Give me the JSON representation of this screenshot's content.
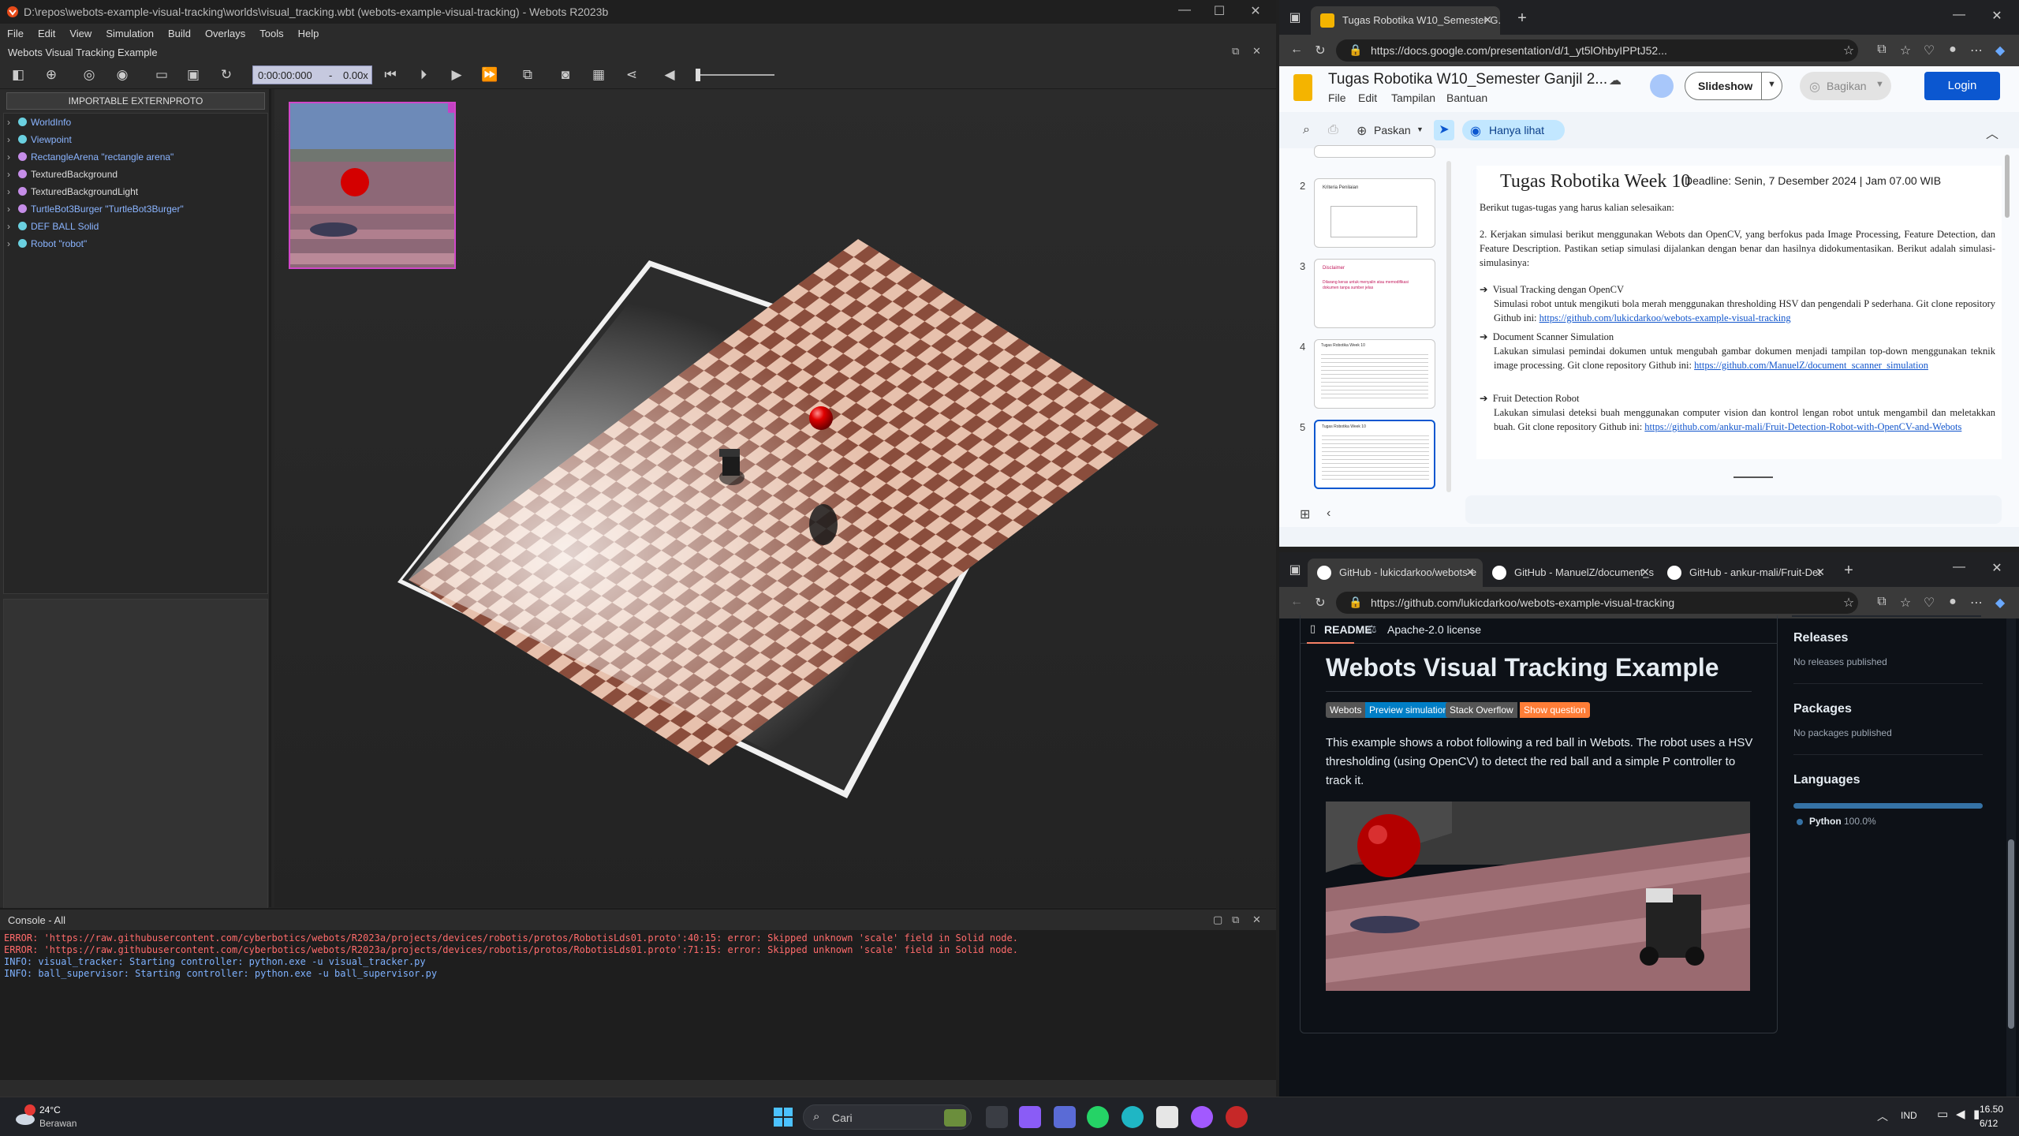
{
  "webots": {
    "title": "D:\\repos\\webots-example-visual-tracking\\worlds\\visual_tracking.wbt (webots-example-visual-tracking) - Webots R2023b",
    "menu": [
      "File",
      "Edit",
      "View",
      "Simulation",
      "Build",
      "Overlays",
      "Tools",
      "Help"
    ],
    "subtitle": "Webots Visual Tracking Example",
    "time": "0:00:00:000",
    "time_sep": "-",
    "speed": "0.00x",
    "extern_button": "IMPORTABLE EXTERNPROTO",
    "tree": [
      {
        "label": "WorldInfo",
        "color": "#6ad0e0"
      },
      {
        "label": "Viewpoint",
        "color": "#6ad0e0"
      },
      {
        "label": "RectangleArena \"rectangle arena\"",
        "color": "#c58de8"
      },
      {
        "label": "TexturedBackground",
        "color": "#c58de8"
      },
      {
        "label": "TexturedBackgroundLight",
        "color": "#c58de8"
      },
      {
        "label": "TurtleBot3Burger \"TurtleBot3Burger\"",
        "color": "#c58de8"
      },
      {
        "label": "DEF BALL Solid",
        "color": "#6ad0e0"
      },
      {
        "label": "Robot \"robot\"",
        "color": "#6ad0e0"
      }
    ],
    "console_title": "Console - All",
    "console": [
      {
        "type": "err",
        "text": "ERROR: 'https://raw.githubusercontent.com/cyberbotics/webots/R2023a/projects/devices/robotis/protos/RobotisLds01.proto':40:15: error: Skipped unknown 'scale' field in Solid node."
      },
      {
        "type": "err",
        "text": "ERROR: 'https://raw.githubusercontent.com/cyberbotics/webots/R2023a/projects/devices/robotis/protos/RobotisLds01.proto':71:15: error: Skipped unknown 'scale' field in Solid node."
      },
      {
        "type": "info",
        "text": "INFO: visual_tracker: Starting controller: python.exe -u visual_tracker.py"
      },
      {
        "type": "info",
        "text": "INFO: ball_supervisor: Starting controller: python.exe -u ball_supervisor.py"
      }
    ]
  },
  "slides": {
    "tab_title": "Tugas Robotika W10_Semester G...",
    "url": "https://docs.google.com/presentation/d/1_yt5lOhbyIPPtJ52...",
    "doc_title": "Tugas Robotika W10_Semester Ganjil 2...",
    "menu": [
      "File",
      "Edit",
      "Tampilan",
      "Bantuan"
    ],
    "slideshow": "Slideshow",
    "share": "Bagikan",
    "login": "Login",
    "zoom_label": "Paskan",
    "view_only": "Hanya lihat",
    "thumb_numbers": [
      "2",
      "3",
      "4",
      "5"
    ],
    "thumb_headers": [
      "Kriteria Penilaian",
      "Disclaimer",
      "Tugas Robotika Week 10",
      "Tugas Robotika Week 10"
    ],
    "thumb3_body": "Dilarang keras untuk menyalin atau memodifikasi dokumen tanpa sumber jelas",
    "slide": {
      "heading": "Tugas Robotika Week 10",
      "deadline": "Deadline: Senin, 7 Desember 2024  | Jam 07.00 WIB",
      "intro": "Berikut tugas-tugas yang harus kalian selesaikan:",
      "item2": "2.  Kerjakan simulasi berikut menggunakan Webots dan OpenCV, yang berfokus pada Image Processing, Feature Detection, dan Feature Description. Pastikan setiap simulasi dijalankan dengan benar dan hasilnya didokumentasikan. Berikut adalah simulasi-simulasinya:",
      "sections": [
        {
          "title": "Visual Tracking dengan OpenCV",
          "body": "Simulasi robot untuk mengikuti bola merah menggunakan thresholding HSV dan pengendali P sederhana. Git clone repository Github ini: ",
          "link": "https://github.com/lukicdarkoo/webots-example-visual-tracking"
        },
        {
          "title": "Document Scanner Simulation",
          "body": "Lakukan simulasi pemindai dokumen untuk mengubah gambar dokumen menjadi tampilan top-down menggunakan teknik image processing. Git clone repository Github ini: ",
          "link": "https://github.com/ManuelZ/document_scanner_simulation"
        },
        {
          "title": "Fruit Detection Robot",
          "body": "Lakukan simulasi deteksi buah menggunakan computer vision dan kontrol lengan robot untuk mengambil dan meletakkan buah. Git clone repository Github ini: ",
          "link": "https://github.com/ankur-mali/Fruit-Detection-Robot-with-OpenCV-and-Webots"
        }
      ]
    }
  },
  "github": {
    "tabs": [
      "GitHub - lukicdarkoo/webots-e",
      "GitHub - ManuelZ/document_s",
      "GitHub - ankur-mali/Fruit-Det"
    ],
    "url": "https://github.com/lukicdarkoo/webots-example-visual-tracking",
    "readme_tab": "README",
    "license_tab": "Apache-2.0 license",
    "heading": "Webots Visual Tracking Example",
    "badges": [
      {
        "left": "Webots",
        "right": "Preview simulation",
        "color": "#007ec6"
      },
      {
        "left": "Stack Overflow",
        "right": "Show question",
        "color": "#fe7d37"
      }
    ],
    "description": "This example shows a robot following a red ball in Webots. The robot uses a HSV thresholding (using OpenCV) to detect the red ball and a simple P controller to track it.",
    "releases": "Releases",
    "releases_sub": "No releases published",
    "packages": "Packages",
    "packages_sub": "No packages published",
    "languages": "Languages",
    "lang_name": "Python",
    "lang_pct": "100.0%"
  },
  "taskbar": {
    "weather_temp": "24°C",
    "weather_desc": "Berawan",
    "search": "Cari",
    "lang": "IND",
    "time": "16.50",
    "date": "6/12"
  }
}
